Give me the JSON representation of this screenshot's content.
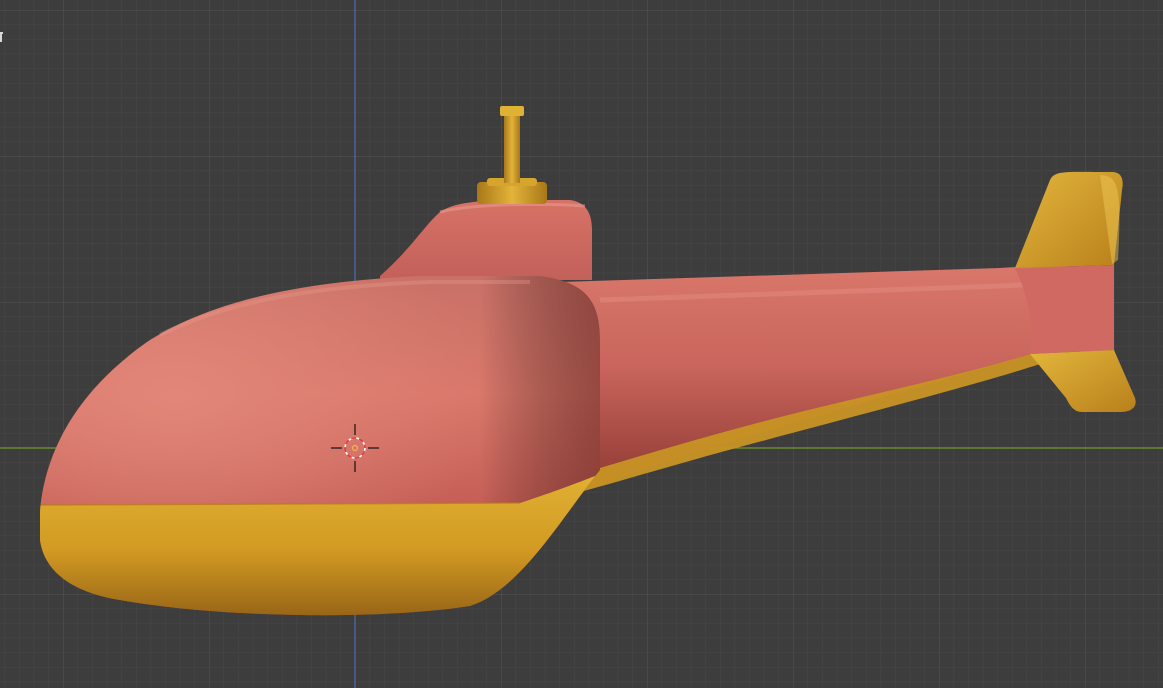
{
  "viewport": {
    "background": "#3d3d3d",
    "grid_minor_color": "#4a4a4a",
    "grid_major_color": "#575757",
    "x_axis_color": "#6f9a2d",
    "z_axis_color": "#4a6fb3"
  },
  "model": {
    "type": "helicopter",
    "body_color": "#d2665e",
    "stripe_color": "#d9a42a"
  },
  "cursor": {
    "icon": "3d-cursor-icon"
  }
}
